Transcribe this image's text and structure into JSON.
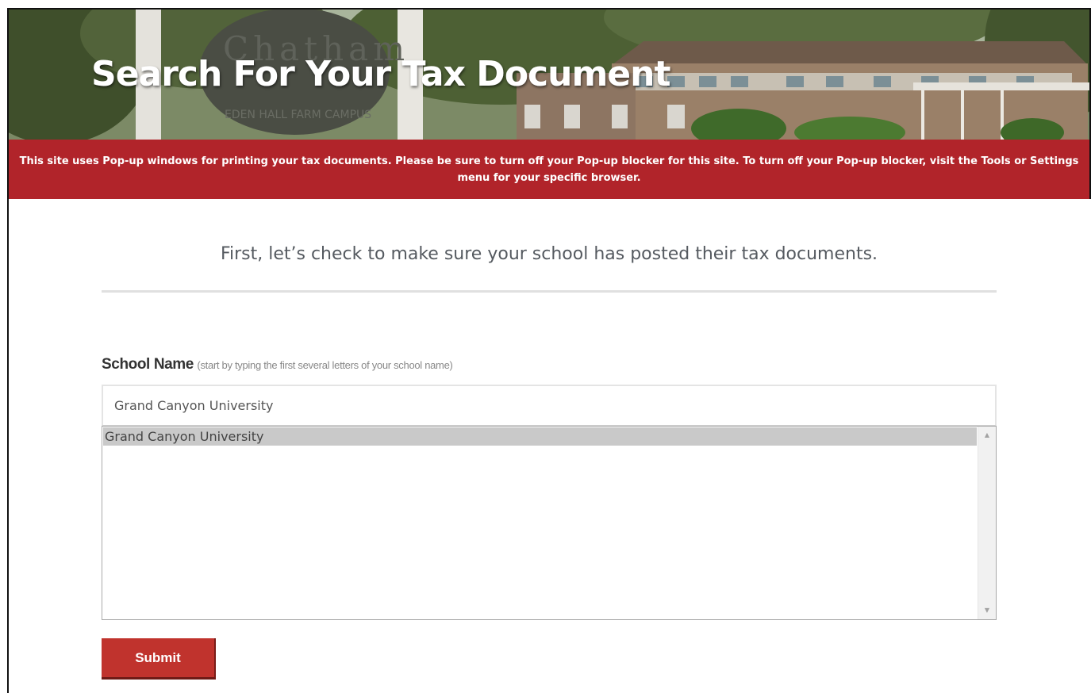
{
  "header": {
    "title": "Search For Your Tax Document",
    "sign_text_1": "Chatham",
    "sign_text_2": "EDEN HALL FARM CAMPUS"
  },
  "notice": {
    "text": "This site uses Pop-up windows for printing your tax documents. Please be sure to turn off your Pop-up blocker for this site. To turn off your Pop-up blocker, visit the Tools or Settings menu for your specific browser."
  },
  "intro": {
    "text": "First, let’s check to make sure your school has posted their tax documents."
  },
  "form": {
    "school_label": "School Name",
    "school_hint": "(start by typing the first several letters of your school name)",
    "school_value": "Grand Canyon University",
    "suggestions": [
      "Grand Canyon University"
    ],
    "submit_label": "Submit"
  },
  "colors": {
    "brand_red": "#b1242a",
    "button_red": "#c0332d",
    "selected_item": "#c9c9c9"
  },
  "icons": {
    "scroll_up": "scroll-up-arrow-icon",
    "scroll_down": "scroll-down-arrow-icon"
  }
}
